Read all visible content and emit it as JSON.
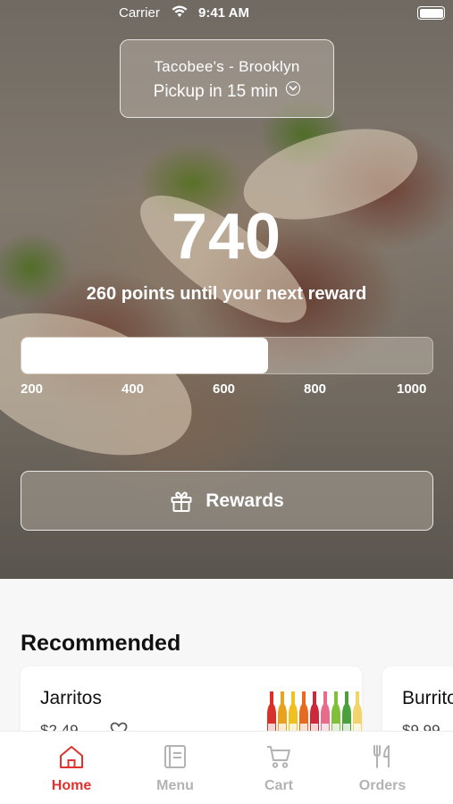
{
  "status_bar": {
    "carrier": "Carrier",
    "time": "9:41 AM"
  },
  "store": {
    "name": "Tacobee's - Brooklyn",
    "pickup": "Pickup in 15 min"
  },
  "loyalty": {
    "points": "740",
    "subtitle": "260 points until your next reward",
    "progress_fraction": 0.6,
    "ticks": [
      "200",
      "400",
      "600",
      "800",
      "1000"
    ]
  },
  "rewards_button": {
    "label": "Rewards",
    "icon": "gift-icon"
  },
  "recommended": {
    "title": "Recommended",
    "items": [
      {
        "name": "Jarritos",
        "price": "$2.49",
        "image": "bottles"
      },
      {
        "name": "Burrito",
        "price": "$9.99"
      }
    ]
  },
  "tabs": [
    {
      "label": "Home",
      "icon": "home-icon",
      "active": true
    },
    {
      "label": "Menu",
      "icon": "menu-icon",
      "active": false
    },
    {
      "label": "Cart",
      "icon": "cart-icon",
      "active": false
    },
    {
      "label": "Orders",
      "icon": "fork-knife-icon",
      "active": false
    }
  ],
  "colors": {
    "accent": "#e0322e",
    "inactive": "#b3b3b3"
  }
}
